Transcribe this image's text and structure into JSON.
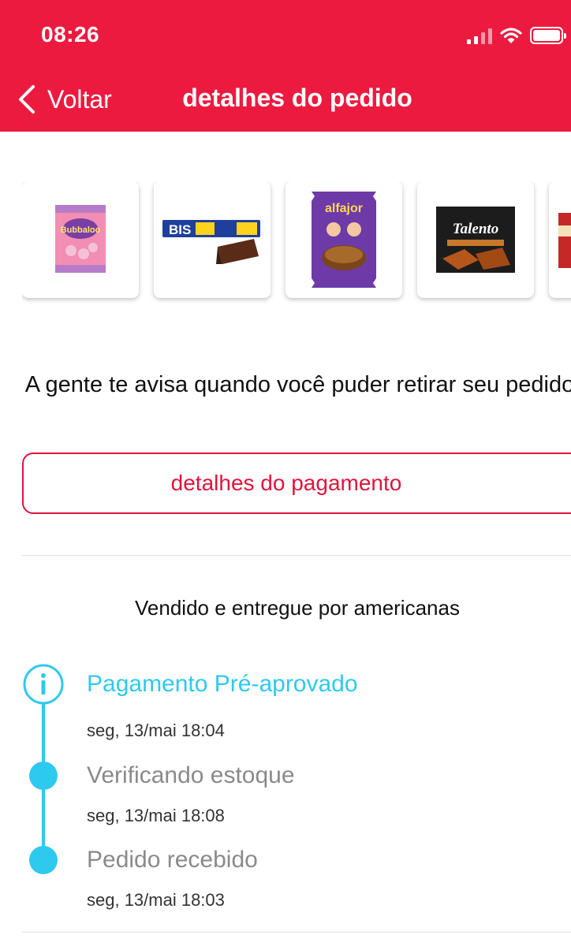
{
  "status_bar": {
    "time": "08:26",
    "icons": [
      "signal-icon",
      "wifi-icon",
      "battery-icon"
    ]
  },
  "nav": {
    "back_label": "Voltar",
    "title": "detalhes do pedido"
  },
  "products": [
    {
      "name": "Bubbaloo",
      "icon": "candy-bag-product-image"
    },
    {
      "name": "Bis Xtra",
      "icon": "wafer-chocolate-product-image"
    },
    {
      "name": "alfajor",
      "icon": "alfajor-product-image"
    },
    {
      "name": "Talento",
      "icon": "chocolate-bar-product-image"
    },
    {
      "name": "",
      "icon": "partial-product-image"
    }
  ],
  "notice": "A gente te avisa quando você puder retirar seu pedido",
  "payment_button": "detalhes do pagamento",
  "seller": "Vendido e entregue por americanas",
  "timeline": [
    {
      "title": "Pagamento Pré-aprovado",
      "date": "seg, 13/mai 18:04",
      "icon": "info-icon"
    },
    {
      "title": "Verificando estoque",
      "date": "seg, 13/mai 18:08",
      "icon": "dot-icon"
    },
    {
      "title": "Pedido recebido",
      "date": "seg, 13/mai 18:03",
      "icon": "dot-icon"
    }
  ],
  "colors": {
    "header": "#ed1a3f",
    "accent": "#e0143c",
    "timeline": "#2ec9ef"
  }
}
